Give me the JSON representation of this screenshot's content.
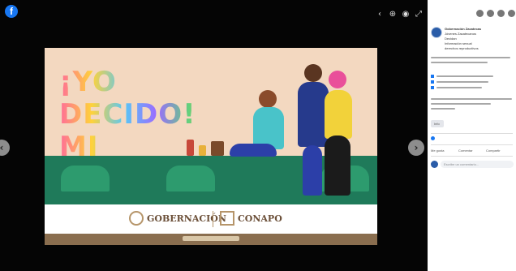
{
  "viewer": {
    "logo": "f",
    "controls": [
      "‹",
      "⊕",
      "◉",
      "⤢"
    ],
    "prev": "‹",
    "next": "›"
  },
  "poster": {
    "headline_line1": "¡YO DECIDO!",
    "headline_line2": "MI FUTURO",
    "footer": {
      "gobernacion": "GOBERNACIÓN",
      "conapo": "CONAPO"
    }
  },
  "sidebar": {
    "page_name": "Gobernación Zacatecas",
    "post_lines": [
      "Jóvenes Zacatecanos",
      "Decidan",
      "Información sexual",
      "derechos reproductivos"
    ],
    "tag": "Info",
    "actions": [
      "Me gusta",
      "Comentar",
      "Compartir"
    ],
    "comment_placeholder": "Escribe un comentario..."
  },
  "colors": {
    "viewer_bg": "#050505",
    "poster_bg": "#f3d8c0",
    "ground": "#1f7a5a",
    "brand": "#1877f2",
    "footer_accent": "#b6956a"
  },
  "icons": [
    "facebook-logo-icon",
    "zoom-out-icon",
    "zoom-in-icon",
    "tag-icon",
    "fullscreen-icon",
    "prev-arrow-icon",
    "next-arrow-icon",
    "like-icon",
    "comment-icon",
    "share-icon"
  ]
}
